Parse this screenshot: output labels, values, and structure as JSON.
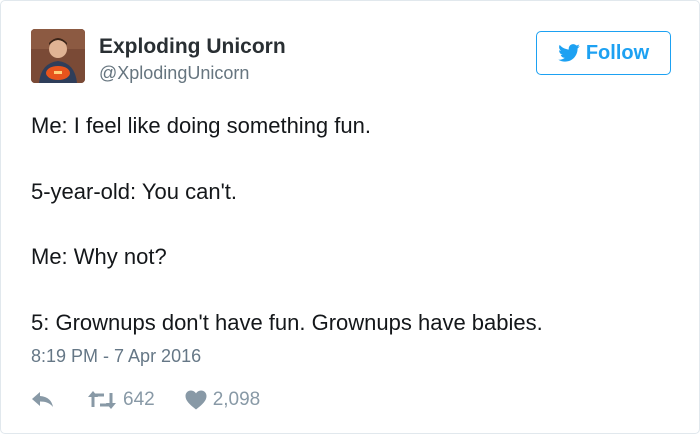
{
  "author": {
    "name": "Exploding Unicorn",
    "handle": "@XplodingUnicorn"
  },
  "follow": {
    "label": "Follow",
    "icon": "twitter-bird-icon",
    "color": "#1da1f2"
  },
  "tweet": {
    "lines": [
      "Me: I feel like doing something fun.",
      "5-year-old: You can't.",
      "Me: Why not?",
      "5: Grownups don't have fun. Grownups have babies."
    ],
    "timestamp": "8:19 PM - 7 Apr 2016"
  },
  "actions": {
    "reply_icon": "reply-icon",
    "retweet_icon": "retweet-icon",
    "retweets": "642",
    "like_icon": "heart-icon",
    "likes": "2,098"
  }
}
